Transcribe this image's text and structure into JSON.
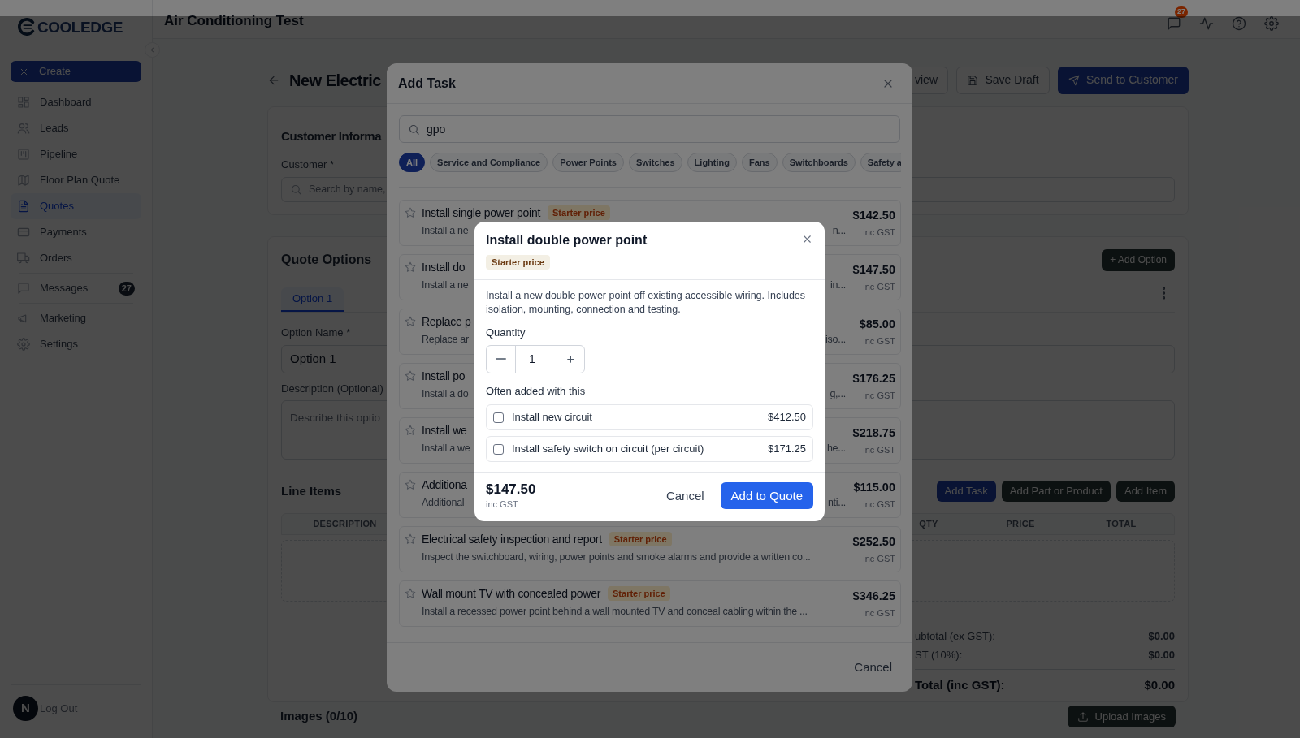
{
  "top_bar": {
    "title": "Air Conditioning Test",
    "messages_badge": "27"
  },
  "sidebar": {
    "logo": "COOLEDGE",
    "create_button": "Create",
    "groups": [
      [
        {
          "label": "Dashboard",
          "selected": false
        },
        {
          "label": "Leads",
          "selected": false
        },
        {
          "label": "Pipeline",
          "selected": false
        },
        {
          "label": "Floor Plan Quote",
          "selected": false
        },
        {
          "label": "Quotes",
          "selected": true
        },
        {
          "label": "Payments",
          "selected": false
        },
        {
          "label": "Orders",
          "selected": false
        }
      ],
      [
        {
          "label": "Messages",
          "selected": false,
          "badge": "27"
        }
      ],
      [
        {
          "label": "Marketing",
          "selected": false
        },
        {
          "label": "Settings",
          "selected": false
        }
      ]
    ],
    "avatar": "N",
    "logout": "Log Out"
  },
  "page": {
    "title": "New Electric",
    "actions": [
      {
        "label": "view",
        "kind": "outline"
      },
      {
        "label": "Save Draft",
        "kind": "outline"
      },
      {
        "label": "Send to Customer",
        "kind": "primary"
      }
    ]
  },
  "customer_card": {
    "title": "Customer Informa",
    "field_label": "Customer *",
    "placeholder": "Search by name,"
  },
  "quote_options": {
    "title": "Quote Options",
    "add_option": "+ Add Option",
    "tabs": [
      {
        "label": "Option 1",
        "selected": true
      }
    ],
    "name_label": "Option Name *",
    "name_value": "Option 1",
    "description_label": "Description (Optional)",
    "description_placeholder": "Describe this optio"
  },
  "line_items": {
    "title": "Line Items",
    "buttons": [
      {
        "label": "Add Task",
        "kind": "primary"
      },
      {
        "label": "Add Part or Product",
        "kind": "dark"
      },
      {
        "label": "Add Item",
        "kind": "dark"
      }
    ],
    "columns": [
      "DESCRIPTION",
      "QTY",
      "PRICE",
      "TOTAL"
    ],
    "totals": [
      {
        "label": "ubtotal (ex GST):",
        "value": "$0.00",
        "kind": "normal"
      },
      {
        "label": "ST (10%):",
        "value": "$0.00",
        "kind": "normal"
      },
      {
        "label": "Total (inc GST):",
        "value": "$0.00",
        "kind": "grand"
      }
    ]
  },
  "images": {
    "title": "Images (0/10)",
    "button": "Upload Images"
  },
  "add_task_modal": {
    "title": "Add Task",
    "search_value": "gpo",
    "chips": [
      {
        "label": "All",
        "selected": true
      },
      {
        "label": "Service and Compliance",
        "selected": false
      },
      {
        "label": "Power Points",
        "selected": false
      },
      {
        "label": "Switches",
        "selected": false
      },
      {
        "label": "Lighting",
        "selected": false
      },
      {
        "label": "Fans",
        "selected": false
      },
      {
        "label": "Switchboards",
        "selected": false
      },
      {
        "label": "Safety a",
        "selected": false
      }
    ],
    "tasks": [
      {
        "title": "Install single power point",
        "badge": "Starter price",
        "description": "Install a ne",
        "description_end": "n...",
        "price": "$142.50",
        "price_note": "inc GST"
      },
      {
        "title": "Install do",
        "description": "Install a ne",
        "description_end": "in...",
        "price": "$147.50",
        "price_note": "inc GST"
      },
      {
        "title": "Replace p",
        "description": "Replace ar",
        "description_end": "iso...",
        "price": "$85.00",
        "price_note": "inc GST"
      },
      {
        "title": "Install po",
        "description": "Install a do",
        "description_end": "g,...",
        "price": "$176.25",
        "price_note": "inc GST"
      },
      {
        "title": "Install we",
        "description": "Install a we",
        "description_end": "he...",
        "price": "$218.75",
        "price_note": "inc GST"
      },
      {
        "title": "Additiona",
        "description": "Additional",
        "description_end": "nti...",
        "price": "$115.00",
        "price_note": "inc GST"
      },
      {
        "title": "Electrical safety inspection and report",
        "badge": "Starter price",
        "description": "Inspect the switchboard, wiring, power points and smoke alarms and provide a written co...",
        "price": "$252.50",
        "price_note": "inc GST"
      },
      {
        "title": "Wall mount TV with concealed power",
        "badge": "Starter price",
        "description": "Install a recessed power point behind a wall mounted TV and conceal cabling within the ...",
        "price": "$346.25",
        "price_note": "inc GST"
      }
    ],
    "cancel": "Cancel"
  },
  "task_dialog": {
    "title": "Install double power point",
    "badge": "Starter price",
    "description": "Install a new double power point off existing accessible wiring. Includes isolation, mounting, connection and testing.",
    "quantity_label": "Quantity",
    "quantity": "1",
    "addons_label": "Often added with this",
    "addons": [
      {
        "label": "Install new circuit",
        "price": "$412.50",
        "checked": false
      },
      {
        "label": "Install safety switch on circuit (per circuit)",
        "price": "$171.25",
        "checked": false
      }
    ],
    "total": "$147.50",
    "total_note": "inc GST",
    "cancel": "Cancel",
    "confirm": "Add to Quote"
  }
}
